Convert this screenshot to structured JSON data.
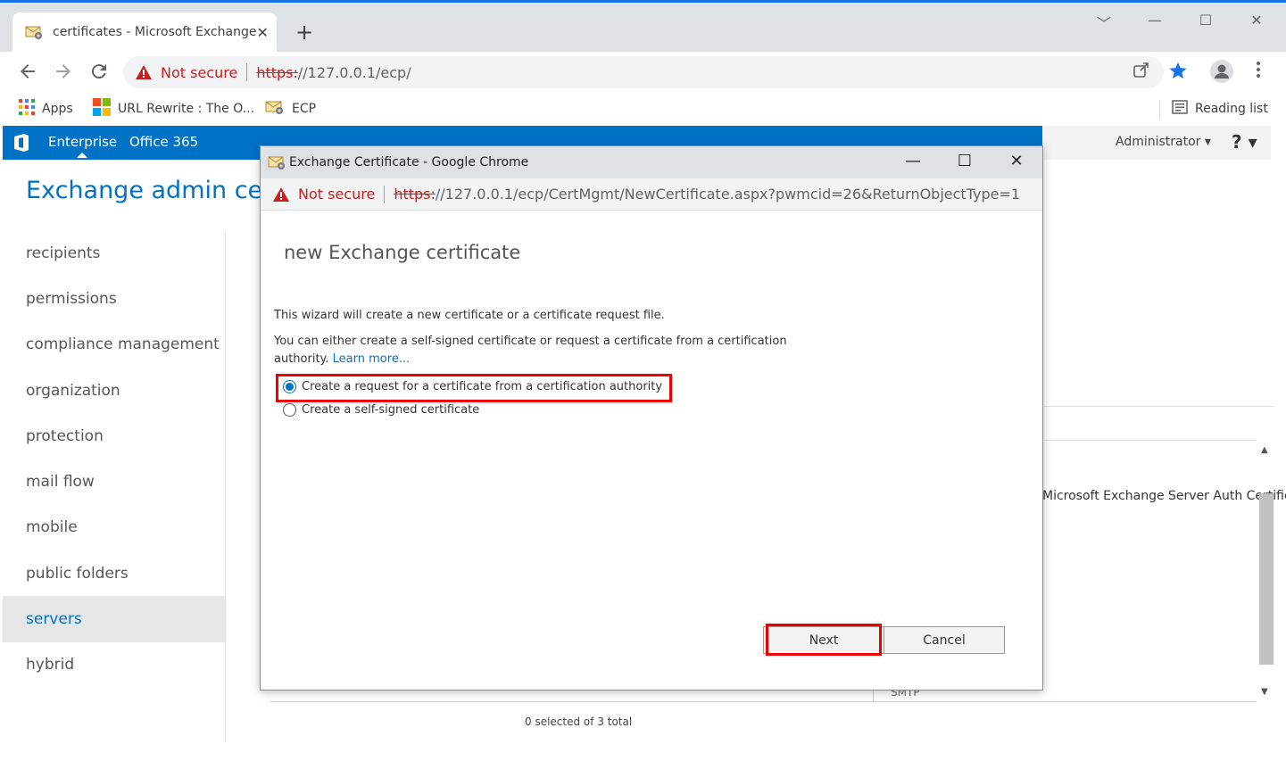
{
  "browser": {
    "tab_title": "certificates - Microsoft Exchange",
    "tab_close": "✕",
    "new_tab": "+",
    "window_controls": [
      "﹀",
      "—",
      "☐",
      "✕"
    ],
    "security_label": "Not secure",
    "url_scheme": "https:",
    "url_rest": "//127.0.0.1/ecp/",
    "bookmarks": [
      {
        "label": "Apps",
        "icon": "apps-grid-icon"
      },
      {
        "label": "URL Rewrite : The O...",
        "icon": "microsoft-logo-icon"
      },
      {
        "label": "ECP",
        "icon": "exchange-envelope-icon"
      }
    ],
    "reading_list": "Reading list"
  },
  "ecp": {
    "top_links": [
      "Enterprise",
      "Office 365"
    ],
    "admin_label": "Administrator ▾",
    "help_label": "? ▾",
    "title": "Exchange admin center",
    "nav": [
      "recipients",
      "permissions",
      "compliance management",
      "organization",
      "protection",
      "mail flow",
      "mobile",
      "public folders",
      "servers",
      "hybrid"
    ],
    "active_nav": "servers",
    "background": {
      "cert_name": "Microsoft Exchange Server Auth Certificate",
      "services": "SMTP",
      "selection_status": "0 selected of 3 total"
    }
  },
  "popup": {
    "window_title": "Exchange Certificate - Google Chrome",
    "controls": [
      "—",
      "☐",
      "✕"
    ],
    "security_label": "Not secure",
    "url_scheme": "https:",
    "url_rest": "//127.0.0.1/ecp/CertMgmt/NewCertificate.aspx?pwmcid=26&ReturnObjectType=1",
    "wizard_title": "new Exchange certificate",
    "intro": "This wizard will create a new certificate or a certificate request file.",
    "description": "You can either create a self-signed certificate or request a certificate from a certification authority.",
    "learn_more": "Learn more...",
    "options": [
      {
        "label": "Create a request for a certificate from a certification authority",
        "checked": true
      },
      {
        "label": "Create a self-signed certificate",
        "checked": false
      }
    ],
    "next_label": "Next",
    "cancel_label": "Cancel"
  },
  "colors": {
    "accent": "#0072c6",
    "highlight": "#ee0000",
    "warning": "#c5221f"
  }
}
